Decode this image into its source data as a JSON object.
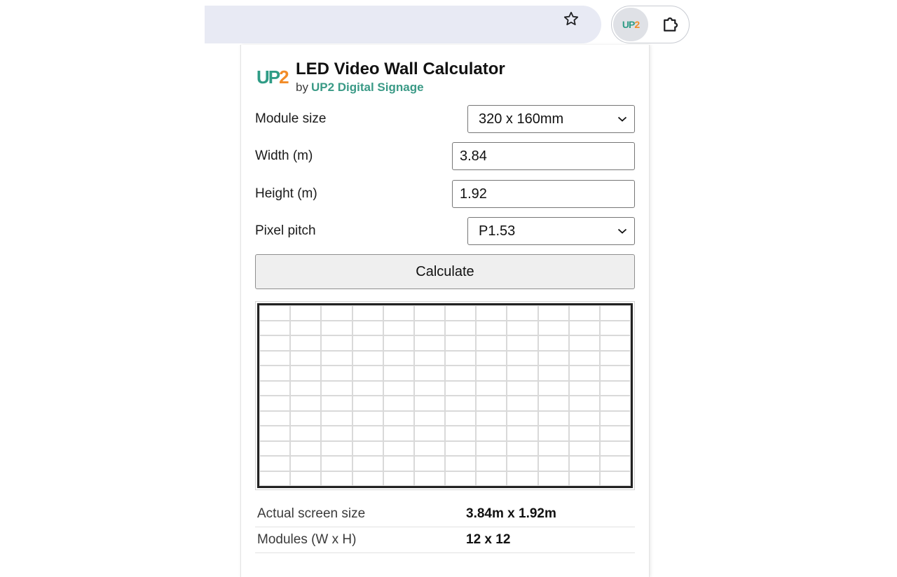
{
  "toolbar": {
    "star_icon": "star-icon",
    "extension_logo": {
      "up": "UP",
      "two": "2"
    },
    "puzzle_icon": "puzzle-icon"
  },
  "popup": {
    "logo": {
      "up": "UP",
      "two": "2"
    },
    "title": "LED Video Wall Calculator",
    "byline_prefix": "by",
    "byline_brand": "UP2 Digital Signage",
    "fields": {
      "module_size": {
        "label": "Module size",
        "value": "320 x 160mm"
      },
      "width": {
        "label": "Width (m)",
        "value": "3.84"
      },
      "height": {
        "label": "Height (m)",
        "value": "1.92"
      },
      "pixel_pitch": {
        "label": "Pixel pitch",
        "value": "P1.53"
      }
    },
    "calculate_label": "Calculate",
    "wall_preview": {
      "columns": 12,
      "rows": 12
    },
    "results": [
      {
        "label": "Actual screen size",
        "value": "3.84m x 1.92m"
      },
      {
        "label": "Modules (W x H)",
        "value": "12 x 12"
      }
    ]
  },
  "colors": {
    "brand_green": "#2f9c86",
    "brand_orange": "#f28c28",
    "omnibox_bg": "#e8eaf4"
  }
}
